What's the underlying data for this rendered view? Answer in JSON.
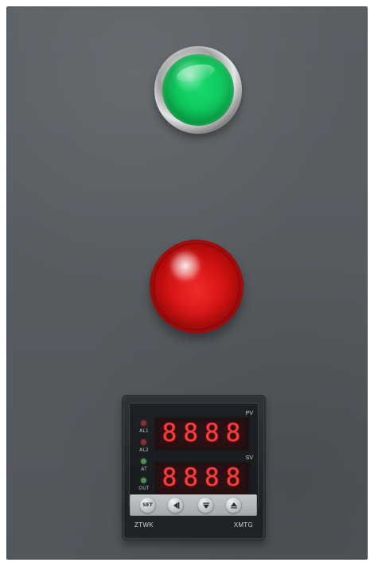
{
  "controller": {
    "pv_label": "PV",
    "sv_label": "SV",
    "indicators": {
      "al1": "AL1",
      "al2": "AL2",
      "at": "AT",
      "out": "OUT"
    },
    "pv_digits": [
      "8",
      "8",
      "8",
      "8"
    ],
    "sv_digits": [
      "8",
      "8",
      "8",
      "8"
    ],
    "buttons": {
      "set": "SET"
    },
    "brand_left": "ZTWK",
    "brand_right": "XMTG"
  },
  "colors": {
    "panel": "#575c61",
    "green_lamp": "#10c95d",
    "red_lamp": "#d91717",
    "display_red": "#ff3b3b"
  },
  "icons": {
    "set_button": "set-icon",
    "shift_button": "left-triangle-icon",
    "down_button": "down-triangle-icon",
    "up_button": "up-triangle-icon"
  }
}
